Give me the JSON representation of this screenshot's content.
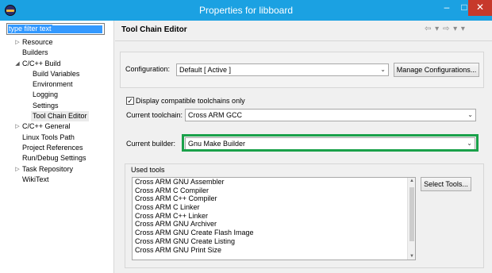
{
  "window": {
    "title": "Properties for libboard"
  },
  "filter": {
    "placeholder": "type filter text"
  },
  "tree": {
    "items": [
      {
        "label": "Resource",
        "arrow": "▷"
      },
      {
        "label": "Builders",
        "arrow": ""
      },
      {
        "label": "C/C++ Build",
        "arrow": "◢"
      },
      {
        "label": "Build Variables",
        "arrow": ""
      },
      {
        "label": "Environment",
        "arrow": ""
      },
      {
        "label": "Logging",
        "arrow": ""
      },
      {
        "label": "Settings",
        "arrow": ""
      },
      {
        "label": "Tool Chain Editor",
        "arrow": ""
      },
      {
        "label": "C/C++ General",
        "arrow": "▷"
      },
      {
        "label": "Linux Tools Path",
        "arrow": ""
      },
      {
        "label": "Project References",
        "arrow": ""
      },
      {
        "label": "Run/Debug Settings",
        "arrow": ""
      },
      {
        "label": "Task Repository",
        "arrow": "▷"
      },
      {
        "label": "WikiText",
        "arrow": ""
      }
    ]
  },
  "page": {
    "title": "Tool Chain Editor",
    "nav": "⇦ ▾ ⇨ ▾ ▾"
  },
  "configuration": {
    "label": "Configuration:",
    "value": "Default  [ Active ]",
    "manage_button": "Manage Configurations..."
  },
  "display_compatible": {
    "label": "Display compatible toolchains only",
    "checked": true
  },
  "toolchain": {
    "label": "Current toolchain:",
    "value": "Cross ARM GCC"
  },
  "builder": {
    "label": "Current builder:",
    "value": "Gnu Make Builder"
  },
  "used_tools": {
    "label": "Used tools",
    "select_button": "Select Tools...",
    "items": [
      "Cross ARM GNU Assembler",
      "Cross ARM C Compiler",
      "Cross ARM C++ Compiler",
      "Cross ARM C Linker",
      "Cross ARM C++ Linker",
      "Cross ARM GNU Archiver",
      "Cross ARM GNU Create Flash Image",
      "Cross ARM GNU Create Listing",
      "Cross ARM GNU Print Size"
    ]
  },
  "colors": {
    "titlebar": "#1ba1e2",
    "highlight": "#1aa14a",
    "close": "#c7392b"
  }
}
